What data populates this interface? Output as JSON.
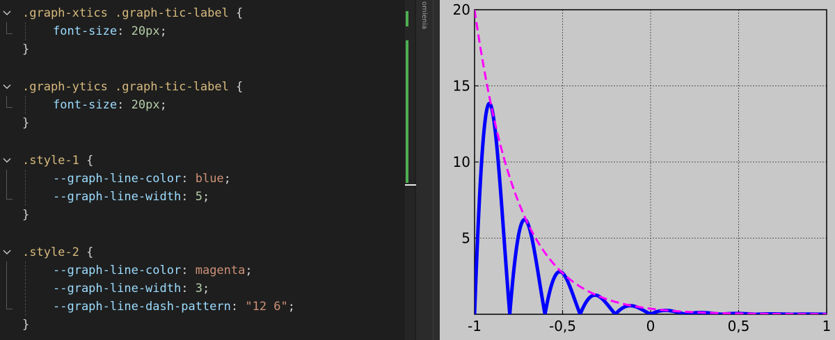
{
  "editor": {
    "lines": [
      {
        "top": 6,
        "fold": true,
        "indent": false,
        "parts": [
          [
            "sel",
            ".graph-xtics .graph-tic-label"
          ],
          [
            "pun",
            " {"
          ]
        ]
      },
      {
        "top": 32,
        "fold": false,
        "indent": true,
        "parts": [
          [
            "prop",
            "font-size"
          ],
          [
            "pun",
            ": "
          ],
          [
            "num",
            "20px"
          ],
          [
            "pun",
            ";"
          ]
        ]
      },
      {
        "top": 58,
        "fold": false,
        "indent": false,
        "parts": [
          [
            "pun",
            "}"
          ]
        ]
      },
      {
        "top": 112,
        "fold": true,
        "indent": false,
        "parts": [
          [
            "sel",
            ".graph-ytics .graph-tic-label"
          ],
          [
            "pun",
            " {"
          ]
        ]
      },
      {
        "top": 138,
        "fold": false,
        "indent": true,
        "parts": [
          [
            "prop",
            "font-size"
          ],
          [
            "pun",
            ": "
          ],
          [
            "num",
            "20px"
          ],
          [
            "pun",
            ";"
          ]
        ]
      },
      {
        "top": 164,
        "fold": false,
        "indent": false,
        "parts": [
          [
            "pun",
            "}"
          ]
        ]
      },
      {
        "top": 218,
        "fold": true,
        "indent": false,
        "parts": [
          [
            "sel",
            ".style-1"
          ],
          [
            "pun",
            " {"
          ]
        ]
      },
      {
        "top": 244,
        "fold": false,
        "indent": true,
        "parts": [
          [
            "var",
            "--graph-line-color"
          ],
          [
            "pun",
            ": "
          ],
          [
            "kw",
            "blue"
          ],
          [
            "pun",
            ";"
          ]
        ]
      },
      {
        "top": 270,
        "fold": false,
        "indent": true,
        "parts": [
          [
            "var",
            "--graph-line-width"
          ],
          [
            "pun",
            ": "
          ],
          [
            "num",
            "5"
          ],
          [
            "pun",
            ";"
          ]
        ]
      },
      {
        "top": 296,
        "fold": false,
        "indent": false,
        "parts": [
          [
            "pun",
            "}"
          ]
        ]
      },
      {
        "top": 350,
        "fold": true,
        "indent": false,
        "parts": [
          [
            "sel",
            ".style-2"
          ],
          [
            "pun",
            " {"
          ]
        ]
      },
      {
        "top": 376,
        "fold": false,
        "indent": true,
        "parts": [
          [
            "var",
            "--graph-line-color"
          ],
          [
            "pun",
            ": "
          ],
          [
            "kw",
            "magenta"
          ],
          [
            "pun",
            ";"
          ]
        ]
      },
      {
        "top": 402,
        "fold": false,
        "indent": true,
        "parts": [
          [
            "var",
            "--graph-line-width"
          ],
          [
            "pun",
            ": "
          ],
          [
            "num",
            "3"
          ],
          [
            "pun",
            ";"
          ]
        ]
      },
      {
        "top": 428,
        "fold": false,
        "indent": true,
        "parts": [
          [
            "var",
            "--graph-line-dash-pattern"
          ],
          [
            "pun",
            ": "
          ],
          [
            "str",
            "\"12 6\""
          ],
          [
            "pun",
            ";"
          ]
        ]
      },
      {
        "top": 454,
        "fold": false,
        "indent": false,
        "parts": [
          [
            "pun",
            "}"
          ]
        ]
      }
    ],
    "fold_icon": "chevron-down-icon"
  },
  "minimap": {
    "label": "omienia"
  },
  "colors": {
    "editor_bg": "#1e1e1e",
    "chart_bg": "#c8c8c8",
    "series_1": "#0000ff",
    "series_2": "#ff00ff",
    "scroll_mark": "#4caf50"
  },
  "chart_data": {
    "type": "line",
    "xlim": [
      -1,
      1
    ],
    "ylim": [
      0,
      20
    ],
    "x_ticks": [
      -1,
      -0.5,
      0,
      0.5,
      1
    ],
    "x_tick_labels": [
      "-1",
      "-0,5",
      "0",
      "0,5",
      "1"
    ],
    "y_ticks": [
      5,
      10,
      15,
      20
    ],
    "y_tick_labels": [
      "5",
      "10",
      "15",
      "20"
    ],
    "grid": true,
    "series": [
      {
        "style": "style-1",
        "color": "blue",
        "line_width": 5,
        "function": "20*exp(-4*(x+1))*|sin(5*pi*x)|"
      },
      {
        "style": "style-2",
        "color": "magenta",
        "line_width": 3,
        "dash": "12 6",
        "function": "20*exp(-4*(x+1))"
      }
    ]
  }
}
